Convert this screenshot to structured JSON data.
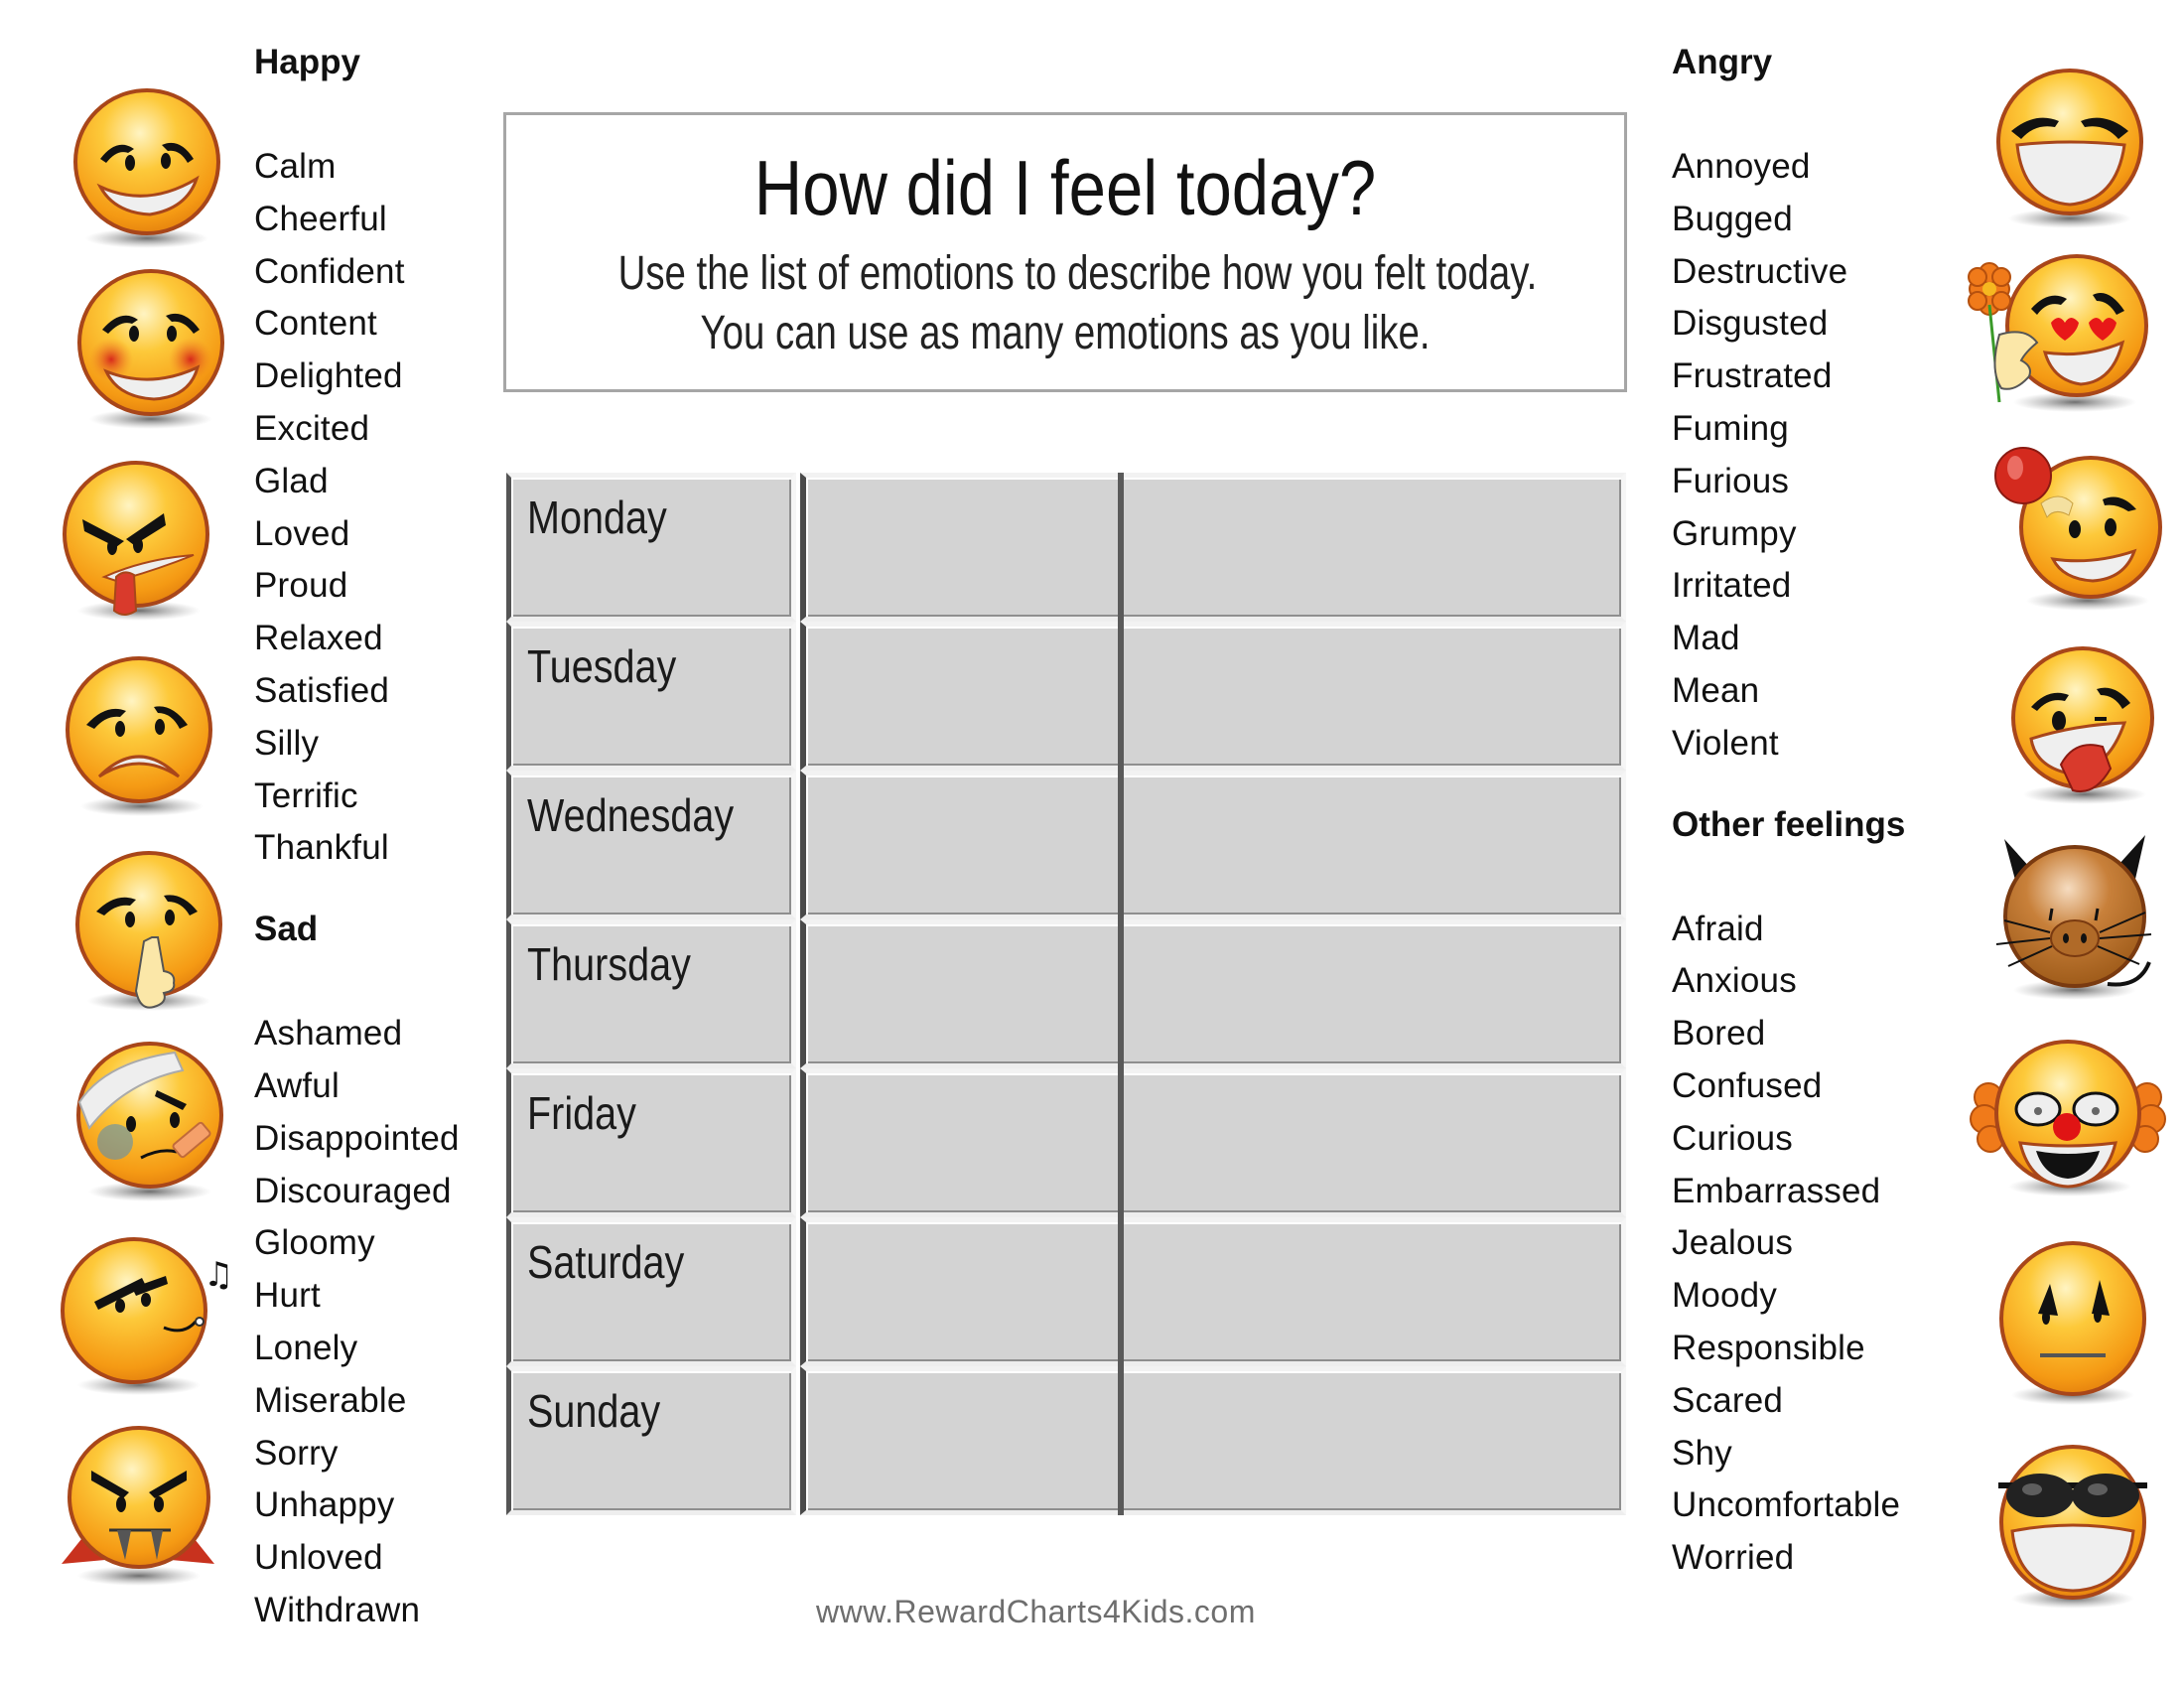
{
  "title_box": {
    "title": "How did I feel today?",
    "subtitle_line1": "Use the list of emotions to describe how you felt today.",
    "subtitle_line2": "You can use as many emotions as you like."
  },
  "left_column": {
    "happy": {
      "heading": "Happy",
      "words": [
        "Calm",
        "Cheerful",
        "Confident",
        "Content",
        "Delighted",
        "Excited",
        "Glad",
        "Loved",
        "Proud",
        "Relaxed",
        "Satisfied",
        "Silly",
        "Terrific",
        "Thankful"
      ]
    },
    "sad": {
      "heading": "Sad",
      "words": [
        "Ashamed",
        "Awful",
        "Disappointed",
        "Discouraged",
        "Gloomy",
        "Hurt",
        "Lonely",
        "Miserable",
        "Sorry",
        "Unhappy",
        "Unloved",
        "Withdrawn"
      ]
    }
  },
  "right_column": {
    "angry": {
      "heading": "Angry",
      "words": [
        "Annoyed",
        "Bugged",
        "Destructive",
        "Disgusted",
        "Frustrated",
        "Fuming",
        "Furious",
        "Grumpy",
        "Irritated",
        "Mad",
        "Mean",
        "Violent"
      ]
    },
    "other": {
      "heading": "Other feelings",
      "words": [
        "Afraid",
        "Anxious",
        "Bored",
        "Confused",
        "Curious",
        "Embarrassed",
        "Jealous",
        "Moody",
        "Responsible",
        "Scared",
        "Shy",
        "Uncomfortable",
        "Worried"
      ]
    }
  },
  "days": [
    "Monday",
    "Tuesday",
    "Wednesday",
    "Thursday",
    "Friday",
    "Saturday",
    "Sunday"
  ],
  "footer": "www.RewardCharts4Kids.com",
  "emojis": {
    "left": [
      "nervous-grin-emoji",
      "blushing-grin-emoji",
      "tongue-out-angry-emoji",
      "sad-frown-emoji",
      "shush-emoji",
      "bandaged-emoji",
      "whistling-emoji",
      "vampire-emoji"
    ],
    "right": [
      "big-grin-emoji",
      "in-love-flower-emoji",
      "bonked-head-emoji",
      "silly-tongue-emoji",
      "cat-emoji",
      "clown-emoji",
      "worried-neutral-emoji",
      "sunglasses-grin-emoji"
    ]
  },
  "colors": {
    "face": "#f7a51c",
    "face_light": "#fde9a0",
    "outline": "#b4521a",
    "cell": "#d3d3d3",
    "footer_text": "#6e6e6e"
  }
}
